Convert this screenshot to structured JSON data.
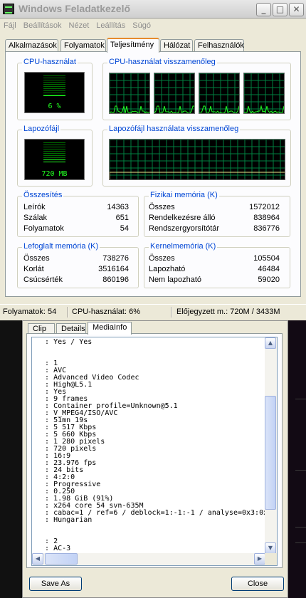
{
  "window": {
    "title": "Windows Feladatkezelő"
  },
  "menu": [
    "Fájl",
    "Beállítások",
    "Nézet",
    "Leállítás",
    "Súgó"
  ],
  "tabs": [
    "Alkalmazások",
    "Folyamatok",
    "Teljesítmény",
    "Hálózat",
    "Felhasználók"
  ],
  "active_tab": "Teljesítmény",
  "cpu": {
    "label": "CPU-használat",
    "value": "6 %",
    "percent": 6
  },
  "cpu_history": {
    "label": "CPU-használat visszamenőleg",
    "cores": 4
  },
  "pagefile": {
    "label": "Lapozófájl",
    "value": "720 MB",
    "fraction": 0.21
  },
  "pagefile_history": {
    "label": "Lapozófájl használata visszamenőleg"
  },
  "totals": {
    "label": "Összesítés",
    "rows": [
      {
        "k": "Leírók",
        "v": "14363"
      },
      {
        "k": "Szálak",
        "v": "651"
      },
      {
        "k": "Folyamatok",
        "v": "54"
      }
    ]
  },
  "physical": {
    "label": "Fizikai memória (K)",
    "rows": [
      {
        "k": "Összes",
        "v": "1572012"
      },
      {
        "k": "Rendelkezésre álló",
        "v": "838964"
      },
      {
        "k": "Rendszergyorsítótár",
        "v": "836776"
      }
    ]
  },
  "commit": {
    "label": "Lefoglalt memória (K)",
    "rows": [
      {
        "k": "Összes",
        "v": "738276"
      },
      {
        "k": "Korlát",
        "v": "3516164"
      },
      {
        "k": "Csúcsérték",
        "v": "860196"
      }
    ]
  },
  "kernel": {
    "label": "Kernelmemória (K)",
    "rows": [
      {
        "k": "Összes",
        "v": "105504"
      },
      {
        "k": "Lapozható",
        "v": "46484"
      },
      {
        "k": "Nem lapozható",
        "v": "59020"
      }
    ]
  },
  "status": {
    "processes": "Folyamatok: 54",
    "cpu": "CPU-használat: 6%",
    "commit": "Előjegyzett m.: 720M / 3433M"
  },
  "mediainfo": {
    "tabs": [
      "Clip",
      "Details",
      "MediaInfo"
    ],
    "active_tab": "MediaInfo",
    "lines": [
      "  : Yes / Yes",
      "",
      "",
      "  : 1",
      "  : AVC",
      "  : Advanced Video Codec",
      "  : High@L5.1",
      "  : Yes",
      "  : 9 frames",
      "  : Container profile=Unknown@5.1",
      "  : V_MPEG4/ISO/AVC",
      "  : 51mn 19s",
      "  : 5 517 Kbps",
      "  : 5 660 Kbps",
      "  : 1 280 pixels",
      "  : 720 pixels",
      "  : 16:9",
      "  : 23.976 fps",
      "  : 24 bits",
      "  : 4:2:0",
      "  : Progressive",
      "  : 0.250",
      "  : 1.98 GiB (91%)",
      "  : x264 core 54 svn-635M",
      "  : cabac=1 / ref=6 / deblock=1:-1:-1 / analyse=0x3:0x",
      "  : Hungarian",
      "",
      "",
      "  : 2",
      "  : AC-3"
    ],
    "save_label": "Save As",
    "close_label": "Close"
  },
  "colors": {
    "accent_tab": "#e68b2c",
    "group_label": "#0046d5",
    "meter_green": "#22ff22",
    "grid_green": "#008040"
  }
}
